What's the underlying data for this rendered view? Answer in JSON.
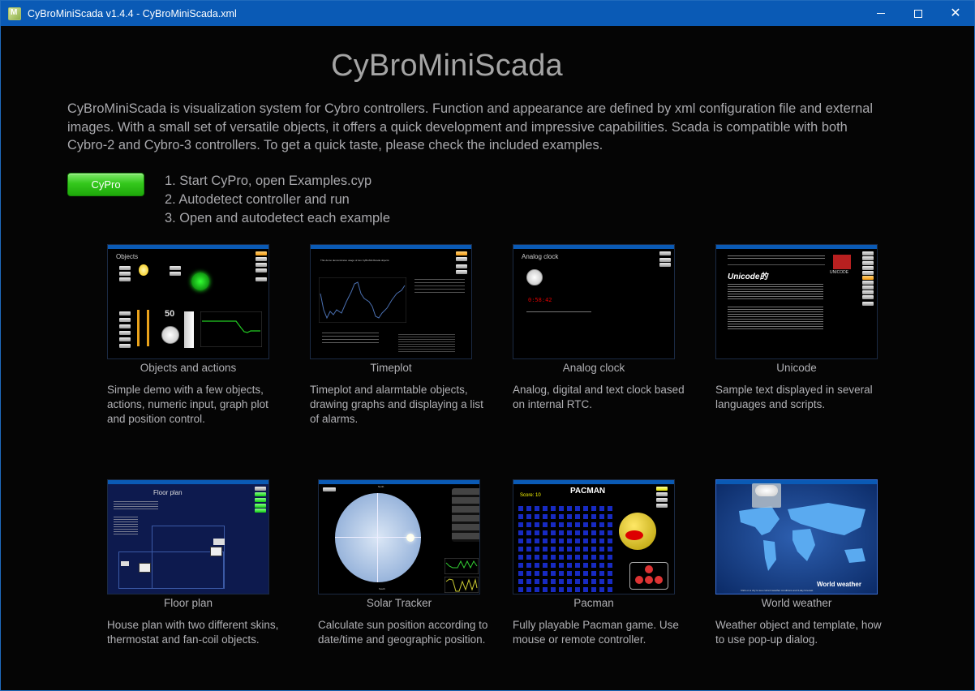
{
  "window": {
    "title": "CyBroMiniScada v1.4.4 - CyBroMiniScada.xml",
    "controls": {
      "minimize": "minimize",
      "maximize": "maximize",
      "close": "✕"
    }
  },
  "header": {
    "title": "CyBroMiniScada",
    "intro": "CyBroMiniScada is visualization system for Cybro controllers. Function and appearance are defined by xml configuration file and external images. With a small set of versatile objects, it offers a quick development and impressive capabilities. Scada is compatible with both Cybro-2 and Cybro-3 controllers. To get a quick taste, please check the included examples."
  },
  "cypro_button": {
    "label": "CyPro",
    "color": "#2cc414"
  },
  "steps": [
    "1. Start CyPro, open Examples.cyp",
    "2. Autodetect controller and run",
    "3. Open and autodetect each example"
  ],
  "examples": [
    {
      "title": "Objects and actions",
      "description": "Simple demo with a few objects, actions, numeric input, graph plot and position control.",
      "thumb_heading": "Objects",
      "thumb_value": "50"
    },
    {
      "title": "Timeplot",
      "description": "Timeplot and alarmtable objects, drawing graphs and displaying a list of alarms.",
      "thumb_heading": "This demo demonstrates usage of two CyBroMiniScada objects:"
    },
    {
      "title": "Analog clock",
      "description": "Analog, digital and text clock based on internal RTC.",
      "thumb_heading": "Analog clock",
      "thumb_value": "0:58:42"
    },
    {
      "title": "Unicode",
      "description": "Sample text displayed in several languages and scripts.",
      "thumb_heading": "Unicode的",
      "thumb_logo": "UNICODE"
    },
    {
      "title": "Floor plan",
      "description": "House plan with two different skins, thermostat and fan-coil objects.",
      "thumb_heading": "Floor plan"
    },
    {
      "title": "Solar Tracker",
      "description": "Calculate sun position according to date/time and geographic position.",
      "thumb_heading": "North",
      "thumb_footer": "South"
    },
    {
      "title": "Pacman",
      "description": "Fully playable Pacman game. Use mouse or remote controller.",
      "thumb_heading": "PACMAN",
      "thumb_value": "Score: 10"
    },
    {
      "title": "World weather",
      "description": "Weather object and template, how to use pop-up dialog.",
      "thumb_heading": "World weather",
      "thumb_footer": "Click on a city to see current weather conditions and 3-day forecast"
    }
  ],
  "colors": {
    "titlebar": "#0a5ab5",
    "background": "#050505",
    "text": "#a8a8ac",
    "accent_green": "#2cc414"
  }
}
